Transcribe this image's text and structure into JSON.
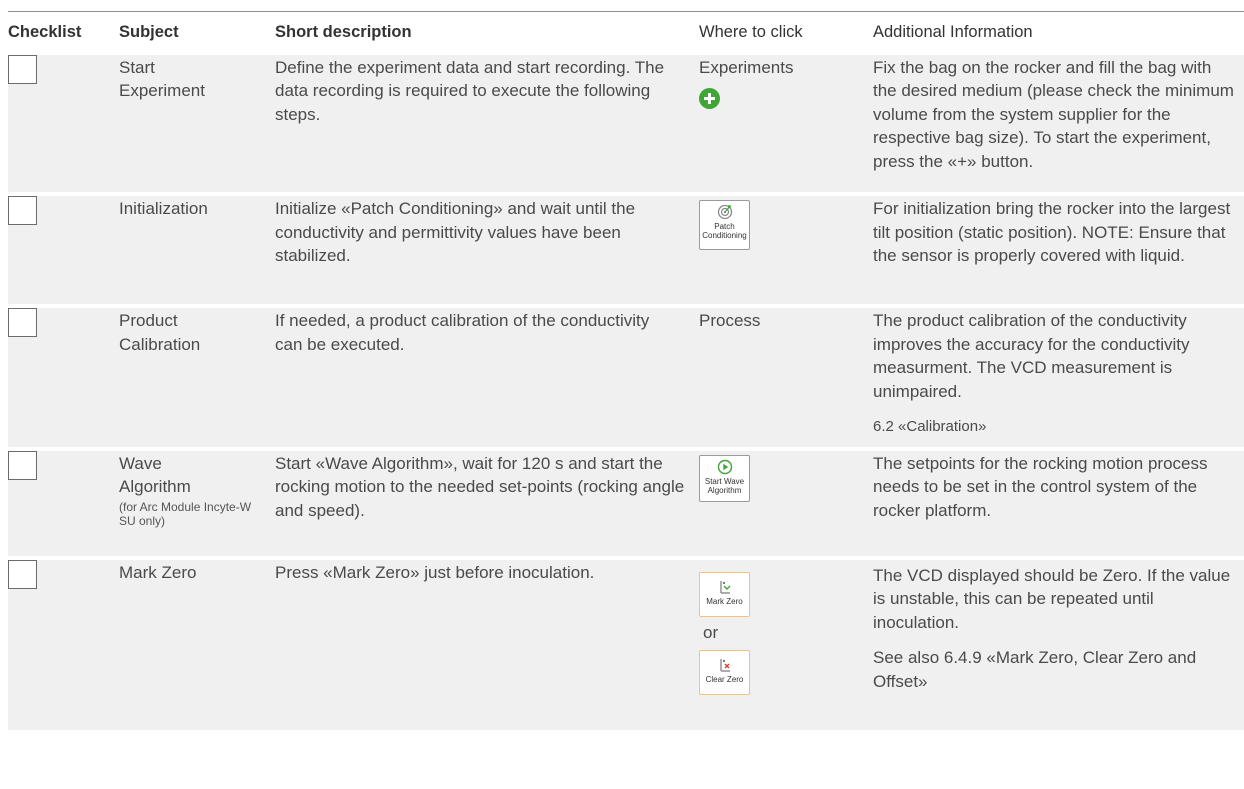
{
  "headers": {
    "checklist": "Checklist",
    "subject": "Subject",
    "description": "Short description",
    "where": "Where to click",
    "info": "Additional Information"
  },
  "rows": [
    {
      "subject": "Start Experiment",
      "description": "Define the experiment data and start recording. The data recording is required to execute the following steps.",
      "where_text": "Experiments",
      "where_icon": "plus-circle-icon",
      "info": "Fix the bag on the rocker and fill the bag with the desired medium (please check the minimum volume from the system supplier for the respective bag size). To start the experiment, press the «+» button."
    },
    {
      "subject": "Initialization",
      "description": "Initialize «Patch Conditioning» and wait until the conductivity and permittivity values have been stabilized.",
      "where_button_label": "Patch Conditioning",
      "where_icon": "patch-conditioning-icon",
      "info": "For initialization bring the rocker into the largest tilt position (static position). NOTE: Ensure that the sensor is properly covered with liquid."
    },
    {
      "subject": "Product Calibration",
      "description": "If needed, a product calibration of the conductivity can be executed.",
      "where_text": "Process",
      "info": "The product calibration of the conductivity improves the accuracy for the conductivity measurment. The VCD measurement is unimpaired.",
      "info_ref": "6.2 «Calibration»"
    },
    {
      "subject": "Wave Algorithm",
      "subject_note": "(for Arc Module Incyte-W SU only)",
      "description": "Start «Wave Algorithm», wait for 120 s and start the rocking motion to the needed set-points (rocking angle and speed).",
      "where_button_label": "Start Wave Algorithm",
      "where_icon": "play-circle-icon",
      "info": "The setpoints for the rocking motion process needs to be set in the control system of the rocker platform."
    },
    {
      "subject": "Mark Zero",
      "description": "Press «Mark Zero» just before inoculation.",
      "where_button_label": "Mark Zero",
      "where_or": "or",
      "where_button2_label": "Clear Zero",
      "info": "The VCD displayed should be Zero. If the value is unstable, this can be repeated until inoculation.",
      "info_ref": "See also 6.4.9 «Mark Zero, Clear Zero and Offset»"
    }
  ],
  "colors": {
    "row_background": "#f0f0f0",
    "plus_icon": "#3fa535",
    "button_border_orange": "#f0c27a"
  }
}
